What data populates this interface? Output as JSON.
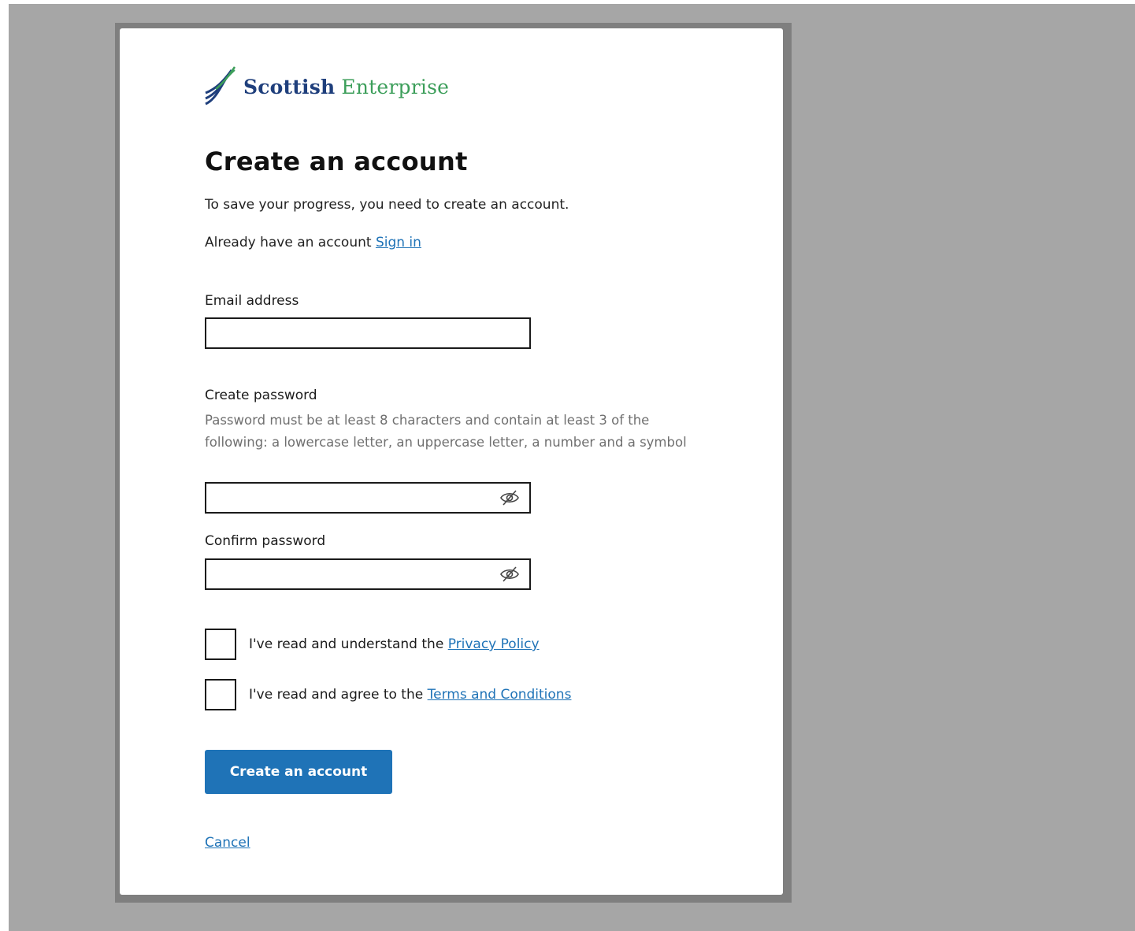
{
  "brand": {
    "name_part1": "Scottish",
    "name_part2": "Enterprise",
    "color_primary": "#1f3f7c",
    "color_secondary": "#3c9e5a"
  },
  "page": {
    "title": "Create an account",
    "intro": "To save your progress, you need to create an account.",
    "already_text": "Already have an account",
    "sign_in_link": "Sign in"
  },
  "form": {
    "email_label": "Email address",
    "email_value": "",
    "password_label": "Create password",
    "password_hint": "Password must be at least 8 characters and contain at least 3 of the following: a lowercase letter, an uppercase letter, a number and a symbol",
    "password_value": "",
    "password_toggle_icon": "eye-slash-icon",
    "confirm_label": "Confirm password",
    "confirm_value": "",
    "privacy_text": "I've read and understand the",
    "privacy_link": "Privacy Policy",
    "privacy_checked": false,
    "terms_text": "I've read and agree to the",
    "terms_link": "Terms and Conditions",
    "terms_checked": false,
    "submit_label": "Create an account",
    "cancel_label": "Cancel"
  },
  "colors": {
    "accent": "#1f73b7",
    "backdrop": "#a6a6a6",
    "hint_text": "#707070"
  }
}
